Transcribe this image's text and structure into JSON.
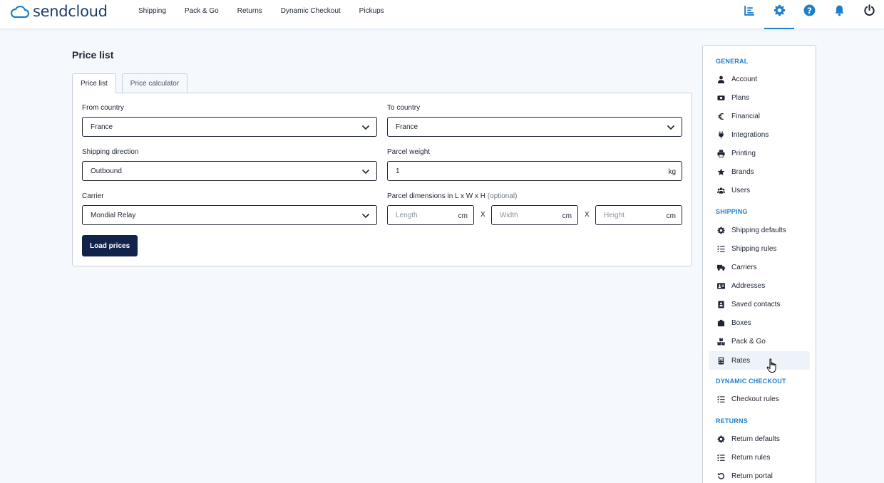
{
  "brand": {
    "name": "sendcloud",
    "accent": "#1f7ec9",
    "primary_button": "#12234a"
  },
  "nav": {
    "links": [
      "Shipping",
      "Pack & Go",
      "Returns",
      "Dynamic Checkout",
      "Pickups"
    ],
    "icons": [
      "analytics-icon",
      "gear-icon",
      "help-icon",
      "bell-icon",
      "power-icon"
    ],
    "active_icon": "gear-icon"
  },
  "page": {
    "title": "Price list",
    "tabs": [
      {
        "label": "Price list",
        "active": true
      },
      {
        "label": "Price calculator",
        "active": false
      }
    ]
  },
  "form": {
    "from_country": {
      "label": "From country",
      "value": "France"
    },
    "to_country": {
      "label": "To country",
      "value": "France"
    },
    "shipping_direction": {
      "label": "Shipping direction",
      "value": "Outbound"
    },
    "parcel_weight": {
      "label": "Parcel weight",
      "value": "1",
      "unit": "kg"
    },
    "carrier": {
      "label": "Carrier",
      "value": "Mondial Relay"
    },
    "dimensions": {
      "label": "Parcel dimensions in L x W x H",
      "optional": "(optional)",
      "separator": "X",
      "length": {
        "placeholder": "Length",
        "unit": "cm"
      },
      "width": {
        "placeholder": "Width",
        "unit": "cm"
      },
      "height": {
        "placeholder": "Height",
        "unit": "cm"
      }
    },
    "submit_label": "Load prices"
  },
  "sidebar": {
    "sections": [
      {
        "title": "GENERAL",
        "items": [
          {
            "label": "Account",
            "icon": "user-icon"
          },
          {
            "label": "Plans",
            "icon": "money-icon"
          },
          {
            "label": "Financial",
            "icon": "euro-icon"
          },
          {
            "label": "Integrations",
            "icon": "plug-icon"
          },
          {
            "label": "Printing",
            "icon": "printer-icon"
          },
          {
            "label": "Brands",
            "icon": "star-icon"
          },
          {
            "label": "Users",
            "icon": "users-icon"
          }
        ]
      },
      {
        "title": "SHIPPING",
        "items": [
          {
            "label": "Shipping defaults",
            "icon": "cog-icon"
          },
          {
            "label": "Shipping rules",
            "icon": "checklist-icon"
          },
          {
            "label": "Carriers",
            "icon": "truck-icon"
          },
          {
            "label": "Addresses",
            "icon": "address-card-icon"
          },
          {
            "label": "Saved contacts",
            "icon": "contact-book-icon"
          },
          {
            "label": "Boxes",
            "icon": "box-icon"
          },
          {
            "label": "Pack & Go",
            "icon": "boxes-icon"
          },
          {
            "label": "Rates",
            "icon": "calculator-icon",
            "hover": true
          }
        ]
      },
      {
        "title": "DYNAMIC CHECKOUT",
        "items": [
          {
            "label": "Checkout rules",
            "icon": "checklist-icon"
          }
        ]
      },
      {
        "title": "RETURNS",
        "items": [
          {
            "label": "Return defaults",
            "icon": "cog-icon"
          },
          {
            "label": "Return rules",
            "icon": "checklist-icon"
          },
          {
            "label": "Return portal",
            "icon": "undo-icon"
          }
        ]
      }
    ]
  }
}
